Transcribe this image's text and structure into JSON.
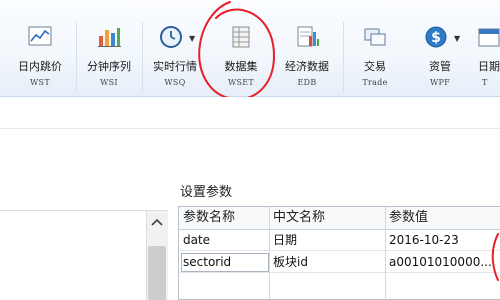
{
  "toolbar": {
    "items": [
      {
        "label": "日内跳价",
        "code": "WST",
        "icon": "intraday-line-chart-icon"
      },
      {
        "label": "分钟序列",
        "code": "WSI",
        "icon": "bar-chart-icon"
      },
      {
        "label": "实时行情",
        "code": "WSQ",
        "icon": "clock-icon",
        "has_dropdown": true
      },
      {
        "label": "数据集",
        "code": "WSET",
        "icon": "dataset-icon"
      },
      {
        "label": "经济数据",
        "code": "EDB",
        "icon": "economic-data-icon"
      },
      {
        "label": "交易",
        "code": "Trade",
        "icon": "trade-icon"
      },
      {
        "label": "资管",
        "code": "WPF",
        "icon": "dollar-coin-icon",
        "has_dropdown": true
      },
      {
        "label": "日期",
        "code": "T",
        "icon": "calendar-icon"
      }
    ],
    "highlight_color": "#e8202a"
  },
  "settings": {
    "title": "设置参数",
    "columns": [
      "参数名称",
      "中文名称",
      "参数值"
    ],
    "rows": [
      {
        "name": "date",
        "cn": "日期",
        "value": "2016-10-23"
      },
      {
        "name": "sectorid",
        "cn": "板块id",
        "value": "a00101010000..."
      }
    ]
  }
}
